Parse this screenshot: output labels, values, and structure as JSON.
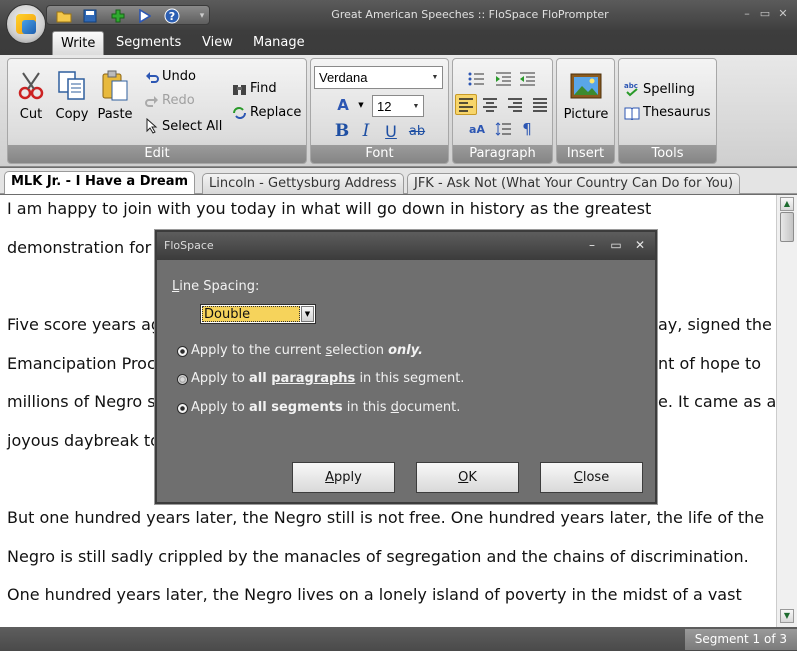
{
  "window": {
    "title": "Great American Speeches :: FloSpace FloPrompter"
  },
  "ribbon_tabs": [
    "Write",
    "Segments",
    "View",
    "Manage"
  ],
  "ribbon": {
    "edit": {
      "caption": "Edit",
      "cut": "Cut",
      "copy": "Copy",
      "paste": "Paste",
      "undo": "Undo",
      "redo": "Redo",
      "select_all": "Select All"
    },
    "find": "Find",
    "replace": "Replace",
    "font": {
      "caption": "Font",
      "family": "Verdana",
      "size": "12"
    },
    "paragraph": {
      "caption": "Paragraph"
    },
    "insert": {
      "caption": "Insert",
      "picture": "Picture"
    },
    "tools": {
      "caption": "Tools",
      "spelling": "Spelling",
      "thesaurus": "Thesaurus"
    }
  },
  "doc_tabs": [
    "MLK Jr. - I Have a Dream",
    "Lincoln - Gettysburg Address",
    "JFK - Ask Not (What Your Country Can Do for You)"
  ],
  "document": {
    "lines": [
      "I am happy to join with you today in what will go down in history as the greatest",
      "demonstration for",
      "",
      "Five score years ag",
      "Emancipation Proc",
      "millions of Negro s",
      "joyous daybreak to",
      "",
      "But one hundred years later, the Negro still is not free. One hundred years later, the life of the",
      "Negro is still sadly crippled by the manacles of segregation and the chains of discrimination.",
      "One hundred years later, the Negro lives on a lonely island of poverty in the midst of a vast"
    ],
    "right_fragments": [
      "ay, signed the",
      "nt of hope to",
      "e. It came as a"
    ]
  },
  "status": {
    "segment": "Segment 1 of 3"
  },
  "dialog": {
    "title": "FloSpace",
    "line_spacing_label_first": "L",
    "line_spacing_label_rest": "ine Spacing:",
    "line_spacing_value": "Double",
    "options": [
      {
        "pre": "Apply to the current ",
        "u": "s",
        "post": "election ",
        "bold": "only.",
        "selected": true
      },
      {
        "pre": "Apply to ",
        "bold": "all ",
        "bold2": "paragraphs",
        "post": " in this segment.",
        "selected": false
      },
      {
        "pre": "Apply to ",
        "bold": "all segments",
        "post": " in this ",
        "u": "d",
        "post2": "ocument.",
        "selected": true
      }
    ],
    "buttons": {
      "apply_u": "A",
      "apply_rest": "pply",
      "ok_u": "O",
      "ok_rest": "K",
      "close_u": "C",
      "close_rest": "lose"
    }
  },
  "colors": {
    "accent_highlight": "#f6d35b",
    "ribbon_caption": "#8f8f8f",
    "titlebar": "#4a4a4a"
  }
}
